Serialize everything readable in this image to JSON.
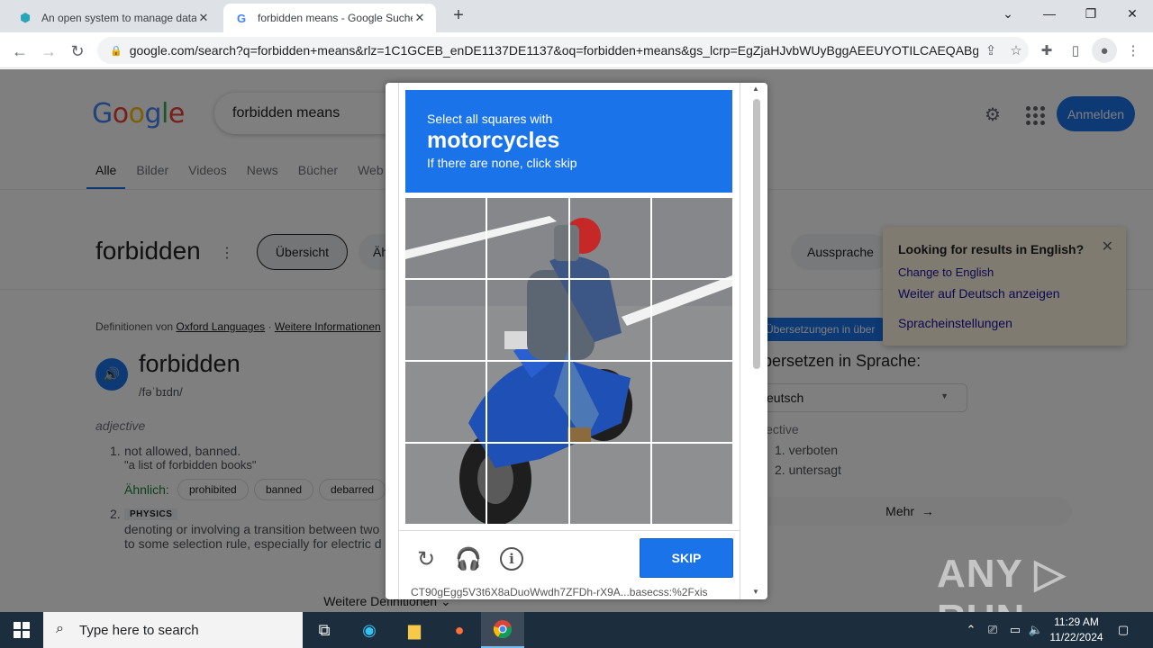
{
  "browser": {
    "tabs": [
      {
        "title": "An open system to manage data",
        "favicon": "cube-icon"
      },
      {
        "title": "forbidden means - Google Suche",
        "favicon": "google-icon"
      }
    ],
    "url": "google.com/search?q=forbidden+means&rlz=1C1GCEB_enDE1137DE1137&oq=forbidden+means&gs_lcrp=EgZjaHJvbWUyBggAEEUYOTILCAEQABg..."
  },
  "google": {
    "logo": "Google",
    "query": "forbidden means",
    "signin_label": "Anmelden",
    "tabs": [
      "Alle",
      "Bilder",
      "Videos",
      "News",
      "Bücher",
      "Web"
    ],
    "word": "forbidden",
    "chips": [
      "Übersicht",
      "Äh",
      "Aussprache"
    ],
    "source_prefix": "Definitionen von",
    "source_name": "Oxford Languages",
    "more_info": "Weitere Informationen",
    "headword": "forbidden",
    "phonetic": "/fəˈbɪdn/",
    "pos": "adjective",
    "sense1_num": "1.",
    "sense1": "not allowed, banned.",
    "sense1_example": "\"a list of forbidden books\"",
    "similar_label": "Ähnlich:",
    "synonyms": [
      "prohibited",
      "banned",
      "debarred"
    ],
    "sense2_num": "2.",
    "sense2_tag": "PHYSICS",
    "sense2_line1": "denoting or involving a transition between two",
    "sense2_line2": "to some selection rule, especially for electric d",
    "more_definitions": "Weitere Definitionen",
    "translations_pill": "Übersetzungen in über",
    "translate_heading": "bersetzen in Sprache:",
    "language": "eutsch",
    "tr_pos": "jective",
    "tr1": "1.  verboten",
    "tr2": "2.  untersagt",
    "more": "Mehr"
  },
  "english_popup": {
    "question": "Looking for results in English?",
    "change": "Change to English",
    "stay": "Weiter auf Deutsch anzeigen",
    "settings": "Spracheinstellungen"
  },
  "captcha": {
    "instruction": "Select all squares with",
    "target": "motorcycles",
    "hint": "If there are none, click skip",
    "skip_label": "SKIP",
    "token": "CT90gEgg5V3t6X8aDuoWwdh7ZFDh-rX9A...basecss:%2Fxis",
    "grid_rows": 4,
    "grid_cols": 4
  },
  "watermark": "ANY RUN",
  "taskbar": {
    "search_placeholder": "Type here to search",
    "time": "11:29 AM",
    "date": "11/22/2024"
  },
  "colors": {
    "accent": "#1a73e8",
    "taskbar": "#1c2d3e",
    "popup_bg": "#fef7e0"
  }
}
